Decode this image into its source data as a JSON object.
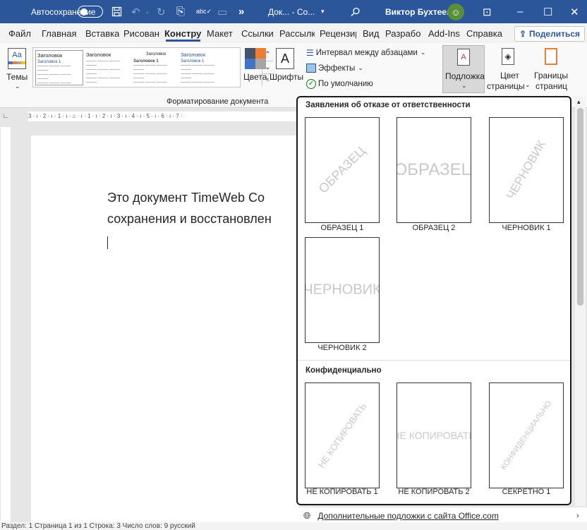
{
  "titlebar": {
    "autosave_label": "Автосохранение",
    "doc_name": "Док... - Со...",
    "user_name": "Виктор Бухтеев",
    "more_icon": "»"
  },
  "tabs": [
    "Файл",
    "Главная",
    "Вставка",
    "Рисовани",
    "Конструк",
    "Макет",
    "Ссылки",
    "Рассылки",
    "Рецензир",
    "Вид",
    "Разрабо",
    "Add-Ins",
    "Справка"
  ],
  "share_label": "Поделиться",
  "ribbon": {
    "themes_label": "Темы",
    "gallery_items": [
      {
        "heading": "Заголовок",
        "sub": "Заголовок 1"
      },
      {
        "heading": "Заголовок",
        "sub": ""
      },
      {
        "heading": "Заголовок",
        "sub": "Заголовок 1"
      },
      {
        "heading": "Заголовок",
        "sub": "Заголовок 1"
      }
    ],
    "colors_label": "Цвета",
    "fonts_label": "Шрифты",
    "paragraph_spacing": "Интервал между абзацами",
    "effects": "Эффекты",
    "set_default": "По умолчанию",
    "group_label": "Форматирование документа",
    "watermark_label": "Подложка",
    "page_color_label1": "Цвет",
    "page_color_label2": "страницы",
    "borders_label1": "Границы",
    "borders_label2": "страниц"
  },
  "ruler_text": "3 · ı · 2 · ı · 1 · ı · ⌂ · ı · 1 · ı · 2 · ı · 3 · ı · 4 · ı · 5 · ı · 6 · ı · 7 ·",
  "document": {
    "line1": "Это документ TimeWeb Co",
    "line2": "сохранения и восстановлен"
  },
  "watermarks": {
    "section1_title": "Заявления об отказе от ответственности",
    "section2_title": "Конфиденциально",
    "items": [
      {
        "text": "ОБРАЗЕЦ",
        "caption": "ОБРАЗЕЦ 1"
      },
      {
        "text": "ОБРАЗЕЦ",
        "caption": "ОБРАЗЕЦ 2"
      },
      {
        "text": "ЧЕРНОВИК",
        "caption": "ЧЕРНОВИК 1"
      },
      {
        "text": "ЧЕРНОВИК",
        "caption": "ЧЕРНОВИК 2"
      },
      {
        "text": "НЕ КОПИРОВАТЬ",
        "caption": "НЕ КОПИРОВАТЬ 1"
      },
      {
        "text": "НЕ КОПИРОВАТЬ",
        "caption": "НЕ КОПИРОВАТЬ 2"
      },
      {
        "text": "КОНФИДЕНЦИАЛЬНО",
        "caption": "СЕКРЕТНО 1"
      }
    ],
    "more_link": "Дополнительные подложки с сайта Office.com"
  },
  "statusbar": "Раздел: 1    Страница 1 из 1    Строка: 3    Число слов: 9         русский",
  "colors": {
    "titlebar": "#2b579a",
    "accent": "#2b579a"
  }
}
